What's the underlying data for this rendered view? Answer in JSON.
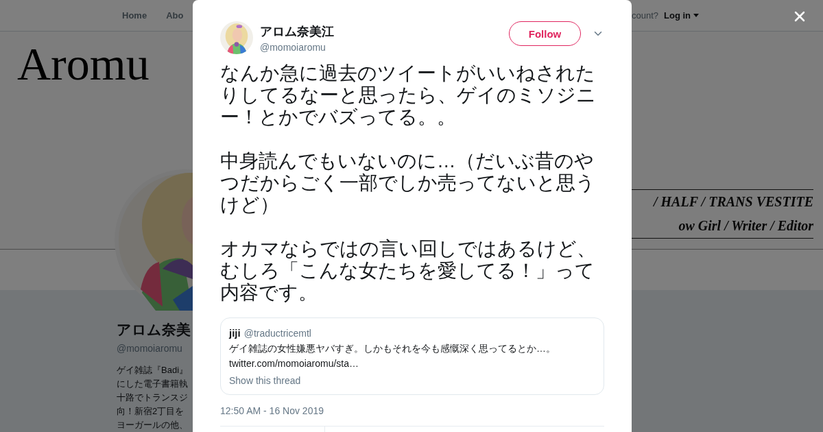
{
  "background_page": {
    "nav": {
      "items": [
        "Home",
        "Abo"
      ],
      "account_prompt": "count?",
      "login": "Log in"
    },
    "banner": {
      "title": "Aromu",
      "tagline_1": "/ HALF / TRANS VESTITE",
      "tagline_2": "ow Girl / Writer / Editor"
    },
    "profile": {
      "name": "アロム奈美",
      "handle": "@momoiaromu",
      "bio_lines": [
        "ゲイ雑誌『Badi』",
        "にした電子書籍執",
        "十路でトランスジ",
        "向！新宿2丁目を",
        "ヨーガールの他、"
      ]
    }
  },
  "dialog": {
    "author": {
      "name": "アロム奈美江",
      "handle": "@momoiaromu"
    },
    "follow_button": "Follow",
    "paragraphs": [
      "なんか急に過去のツイートがいいねされたりしてるなーと思ったら、ゲイのミソジニー！とかでバズってる。。",
      "中身読んでもいないのに…（だいぶ昔のやつだからごく一部でしか売ってないと思うけど）",
      "オカマならではの言い回しではあるけど、むしろ「こんな女たちを愛してる！」って内容です。"
    ],
    "quote": {
      "name": "jiji",
      "handle": "@traductricemtl",
      "text": "ゲイ雑誌の女性嫌悪ヤバすぎ。しかもそれを今も感慨深く思ってるとか…。",
      "link": "twitter.com/momoiaromu/sta…",
      "show_thread": "Show this thread"
    },
    "timestamp": "12:50 AM - 16 Nov 2019"
  }
}
